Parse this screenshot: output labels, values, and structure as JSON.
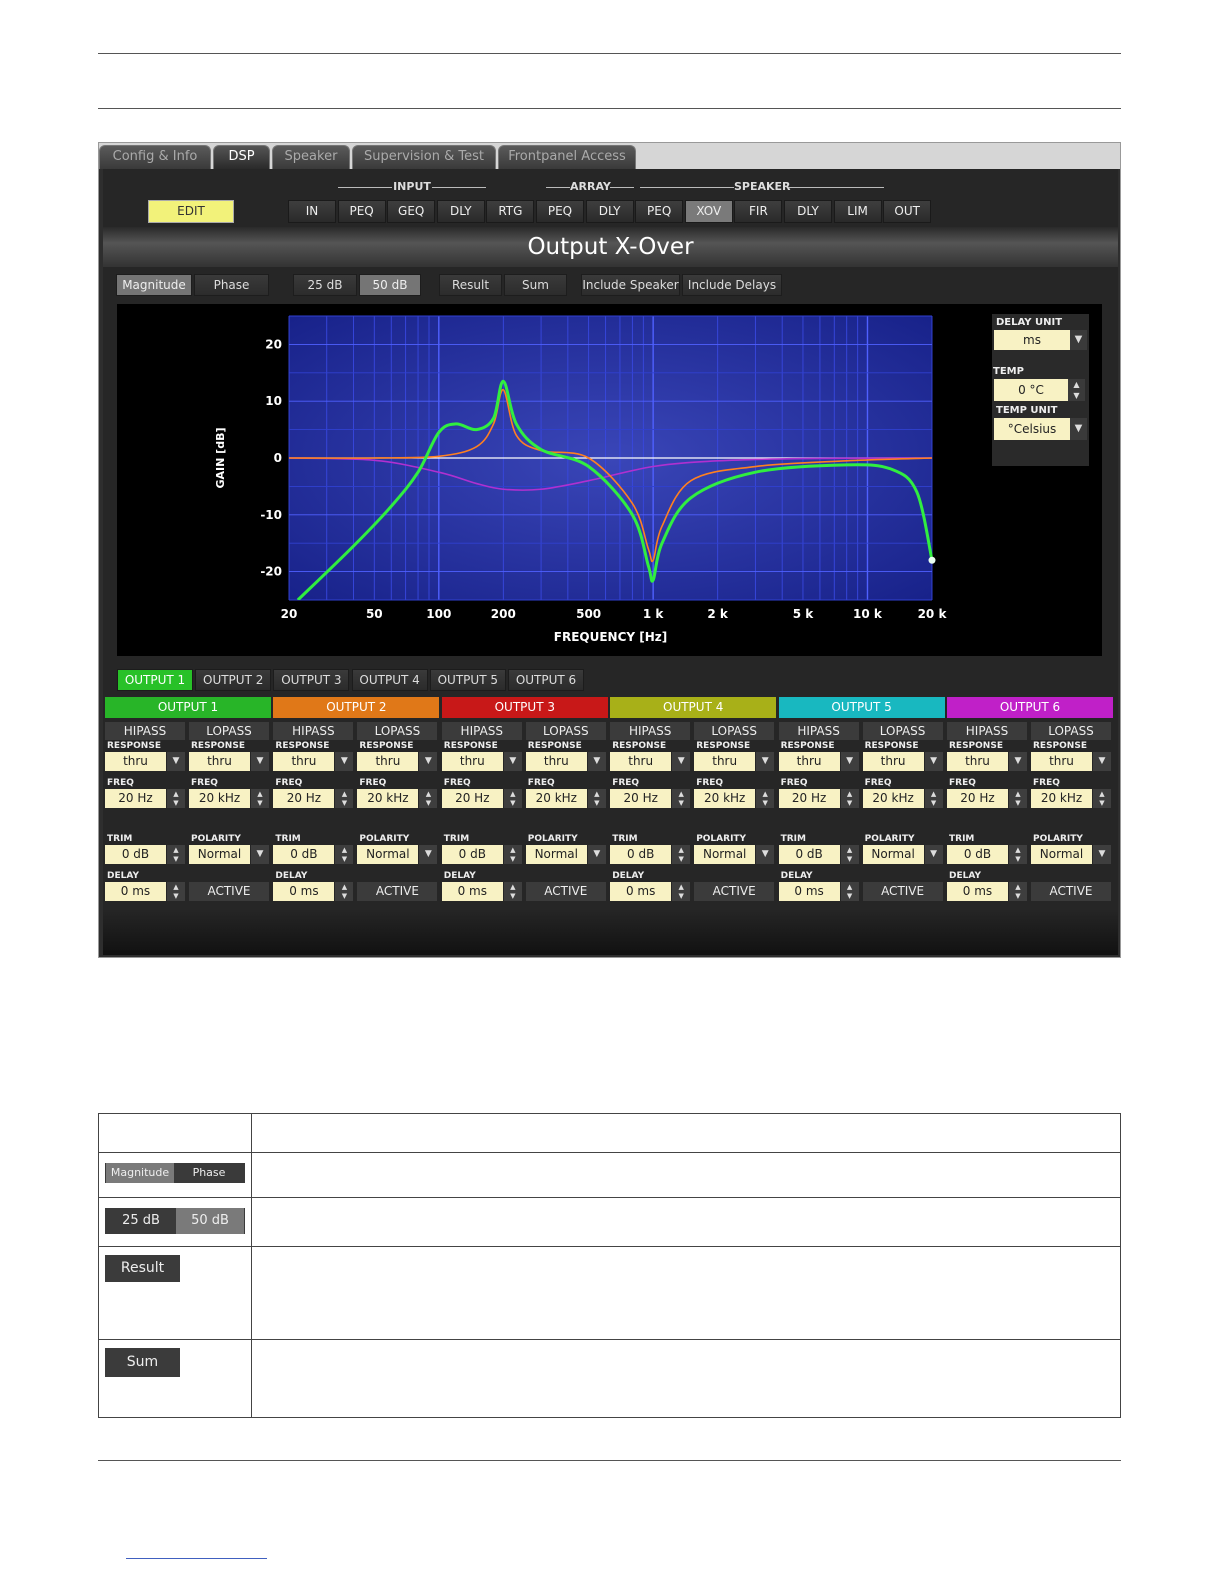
{
  "tabs": [
    {
      "label": "Config & Info",
      "active": false
    },
    {
      "label": "DSP",
      "active": true
    },
    {
      "label": "Speaker",
      "active": false
    },
    {
      "label": "Supervision & Test",
      "active": false
    },
    {
      "label": "Frontpanel Access",
      "active": false
    }
  ],
  "edit_label": "EDIT",
  "groups": {
    "input": "INPUT",
    "array": "ARRAY",
    "speaker": "SPEAKER"
  },
  "chain": [
    "IN",
    "PEQ",
    "GEQ",
    "DLY",
    "RTG",
    "PEQ",
    "DLY",
    "PEQ",
    "XOV",
    "FIR",
    "DLY",
    "LIM",
    "OUT"
  ],
  "chain_selected": "XOV",
  "page_title": "Output X-Over",
  "view_buttons": {
    "magnitude": "Magnitude",
    "phase": "Phase",
    "range25": "25 dB",
    "range50": "50 dB",
    "result": "Result",
    "sum": "Sum",
    "include_speaker": "Include Speaker",
    "include_delays": "Include Delays"
  },
  "side_panel": {
    "delay_unit_label": "DELAY UNIT",
    "delay_unit_value": "ms",
    "temp_label": "TEMP",
    "temp_value": "0 °C",
    "temp_unit_label": "TEMP UNIT",
    "temp_unit_value": "°Celsius"
  },
  "chart_data": {
    "type": "line",
    "xlabel": "FREQUENCY [Hz]",
    "ylabel": "GAIN [dB]",
    "xscale": "log",
    "xlim": [
      20,
      20000
    ],
    "ylim": [
      -25,
      25
    ],
    "x_ticks": [
      20,
      50,
      100,
      200,
      500,
      1000,
      2000,
      5000,
      10000,
      20000
    ],
    "x_tick_labels": [
      "20",
      "50",
      "100",
      "200",
      "500",
      "1 k",
      "2 k",
      "5 k",
      "10 k",
      "20 k"
    ],
    "y_ticks": [
      20,
      10,
      0,
      -10,
      -20
    ],
    "y_tick_labels": [
      "20",
      "10",
      "0",
      "-10",
      "-20"
    ],
    "background": "#1a2a9a",
    "series": [
      {
        "color": "#ffffff",
        "x": [
          20,
          20000
        ],
        "y": [
          0,
          0
        ]
      },
      {
        "color": "#b030d0",
        "x": [
          20,
          50,
          100,
          150,
          200,
          300,
          500,
          1000,
          2000,
          5000,
          20000
        ],
        "y": [
          0,
          -0.4,
          -2.5,
          -4.5,
          -5.5,
          -5.5,
          -4,
          -1.5,
          -0.5,
          -0.1,
          0
        ]
      },
      {
        "color": "#ff8020",
        "x": [
          20,
          50,
          100,
          150,
          180,
          200,
          230,
          300,
          500,
          800,
          950,
          1000,
          1100,
          1500,
          3000,
          8000,
          20000
        ],
        "y": [
          0,
          0,
          0.3,
          2,
          6,
          12,
          4,
          1.3,
          0,
          -8,
          -16,
          -18,
          -12,
          -4,
          -1.5,
          -0.5,
          0
        ]
      },
      {
        "color": "#30ee40",
        "x": [
          22,
          40,
          60,
          80,
          100,
          120,
          150,
          180,
          200,
          230,
          300,
          500,
          800,
          950,
          1000,
          1100,
          1500,
          3000,
          8000,
          13000,
          17000,
          20000
        ],
        "y": [
          -25,
          -15.5,
          -8.5,
          -2.5,
          4.5,
          6,
          5,
          7,
          13.5,
          6,
          1.5,
          -1.5,
          -10,
          -19,
          -21.5,
          -15,
          -7,
          -2.5,
          -1.2,
          -2,
          -6,
          -18
        ]
      }
    ]
  },
  "output_tabs": [
    {
      "label": "OUTPUT 1",
      "active": true
    },
    {
      "label": "OUTPUT 2",
      "active": false
    },
    {
      "label": "OUTPUT 3",
      "active": false
    },
    {
      "label": "OUTPUT 4",
      "active": false
    },
    {
      "label": "OUTPUT 5",
      "active": false
    },
    {
      "label": "OUTPUT 6",
      "active": false
    }
  ],
  "field_labels": {
    "hipass": "HIPASS",
    "lopass": "LOPASS",
    "response": "RESPONSE",
    "freq": "FREQ",
    "trim": "TRIM",
    "polarity": "POLARITY",
    "delay": "DELAY",
    "active": "ACTIVE"
  },
  "outputs": [
    {
      "name": "OUTPUT 1",
      "color": "#28b528",
      "hp_response": "thru",
      "lp_response": "thru",
      "hp_freq": "20 Hz",
      "lp_freq": "20 kHz",
      "trim": "0 dB",
      "polarity": "Normal",
      "delay": "0 ms"
    },
    {
      "name": "OUTPUT 2",
      "color": "#e07818",
      "hp_response": "thru",
      "lp_response": "thru",
      "hp_freq": "20 Hz",
      "lp_freq": "20 kHz",
      "trim": "0 dB",
      "polarity": "Normal",
      "delay": "0 ms"
    },
    {
      "name": "OUTPUT 3",
      "color": "#c81818",
      "hp_response": "thru",
      "lp_response": "thru",
      "hp_freq": "20 Hz",
      "lp_freq": "20 kHz",
      "trim": "0 dB",
      "polarity": "Normal",
      "delay": "0 ms"
    },
    {
      "name": "OUTPUT 4",
      "color": "#a8b018",
      "hp_response": "thru",
      "lp_response": "thru",
      "hp_freq": "20 Hz",
      "lp_freq": "20 kHz",
      "trim": "0 dB",
      "polarity": "Normal",
      "delay": "0 ms"
    },
    {
      "name": "OUTPUT 5",
      "color": "#18b8c0",
      "hp_response": "thru",
      "lp_response": "thru",
      "hp_freq": "20 Hz",
      "lp_freq": "20 kHz",
      "trim": "0 dB",
      "polarity": "Normal",
      "delay": "0 ms"
    },
    {
      "name": "OUTPUT 6",
      "color": "#c020c8",
      "hp_response": "thru",
      "lp_response": "thru",
      "hp_freq": "20 Hz",
      "lp_freq": "20 kHz",
      "trim": "0 dB",
      "polarity": "Normal",
      "delay": "0 ms"
    }
  ],
  "legend_rows": [
    {
      "buttons": [
        "Magnitude",
        "Phase"
      ],
      "text": ""
    },
    {
      "buttons": [
        "25 dB",
        "50 dB"
      ],
      "text": ""
    },
    {
      "buttons": [
        "Result"
      ],
      "text": ""
    },
    {
      "buttons": [
        "Sum"
      ],
      "text": ""
    }
  ]
}
